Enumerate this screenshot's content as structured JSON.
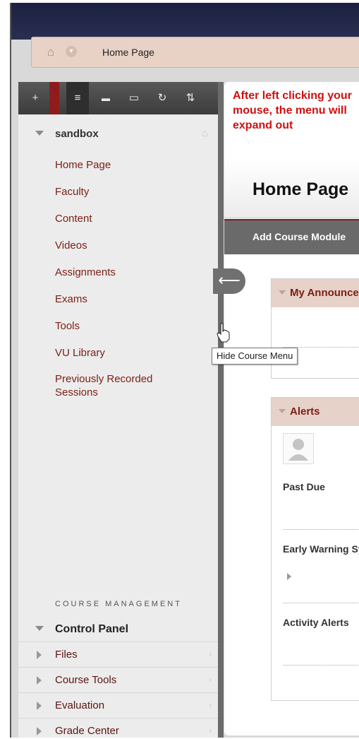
{
  "breadcrumb": {
    "current": "Home Page"
  },
  "sidebar": {
    "toolbar": [
      {
        "glyph": "+",
        "icon": "add-icon"
      },
      {
        "glyph": "≡",
        "icon": "list-view-icon"
      },
      {
        "glyph": "▬",
        "icon": "folder-view-icon"
      },
      {
        "glyph": "▭",
        "icon": "window-icon"
      },
      {
        "glyph": "↻",
        "icon": "refresh-icon"
      },
      {
        "glyph": "⇅",
        "icon": "reorder-icon"
      }
    ],
    "course_name": "sandbox",
    "menu_items": [
      {
        "label": "Home Page"
      },
      {
        "label": "Faculty"
      },
      {
        "label": "Content"
      },
      {
        "label": "Videos"
      },
      {
        "label": "Assignments"
      },
      {
        "label": "Exams"
      },
      {
        "label": "Tools"
      },
      {
        "label": "VU Library"
      },
      {
        "label": "Previously Recorded Sessions"
      }
    ],
    "management_heading": "COURSE MANAGEMENT",
    "control_panel": "Control Panel",
    "management_items": [
      {
        "label": "Files"
      },
      {
        "label": "Course Tools"
      },
      {
        "label": "Evaluation"
      },
      {
        "label": "Grade Center"
      }
    ]
  },
  "hide_menu": {
    "arrow": "⟵",
    "tooltip": "Hide Course Menu"
  },
  "annotation": "After left clicking your mouse, the menu will expand out",
  "content": {
    "page_title": "Home Page",
    "add_module_label": "Add Course Module",
    "announcements_title": "My Announcements",
    "alerts_title": "Alerts",
    "past_due": "Past Due",
    "early_warning": "Early Warning System",
    "activity_alerts": "Activity Alerts"
  },
  "colors": {
    "accent": "#7d1d14",
    "annotation": "#d01010",
    "topbar": "#1b2140",
    "breadcrumb_bg": "#e8d2c6"
  }
}
